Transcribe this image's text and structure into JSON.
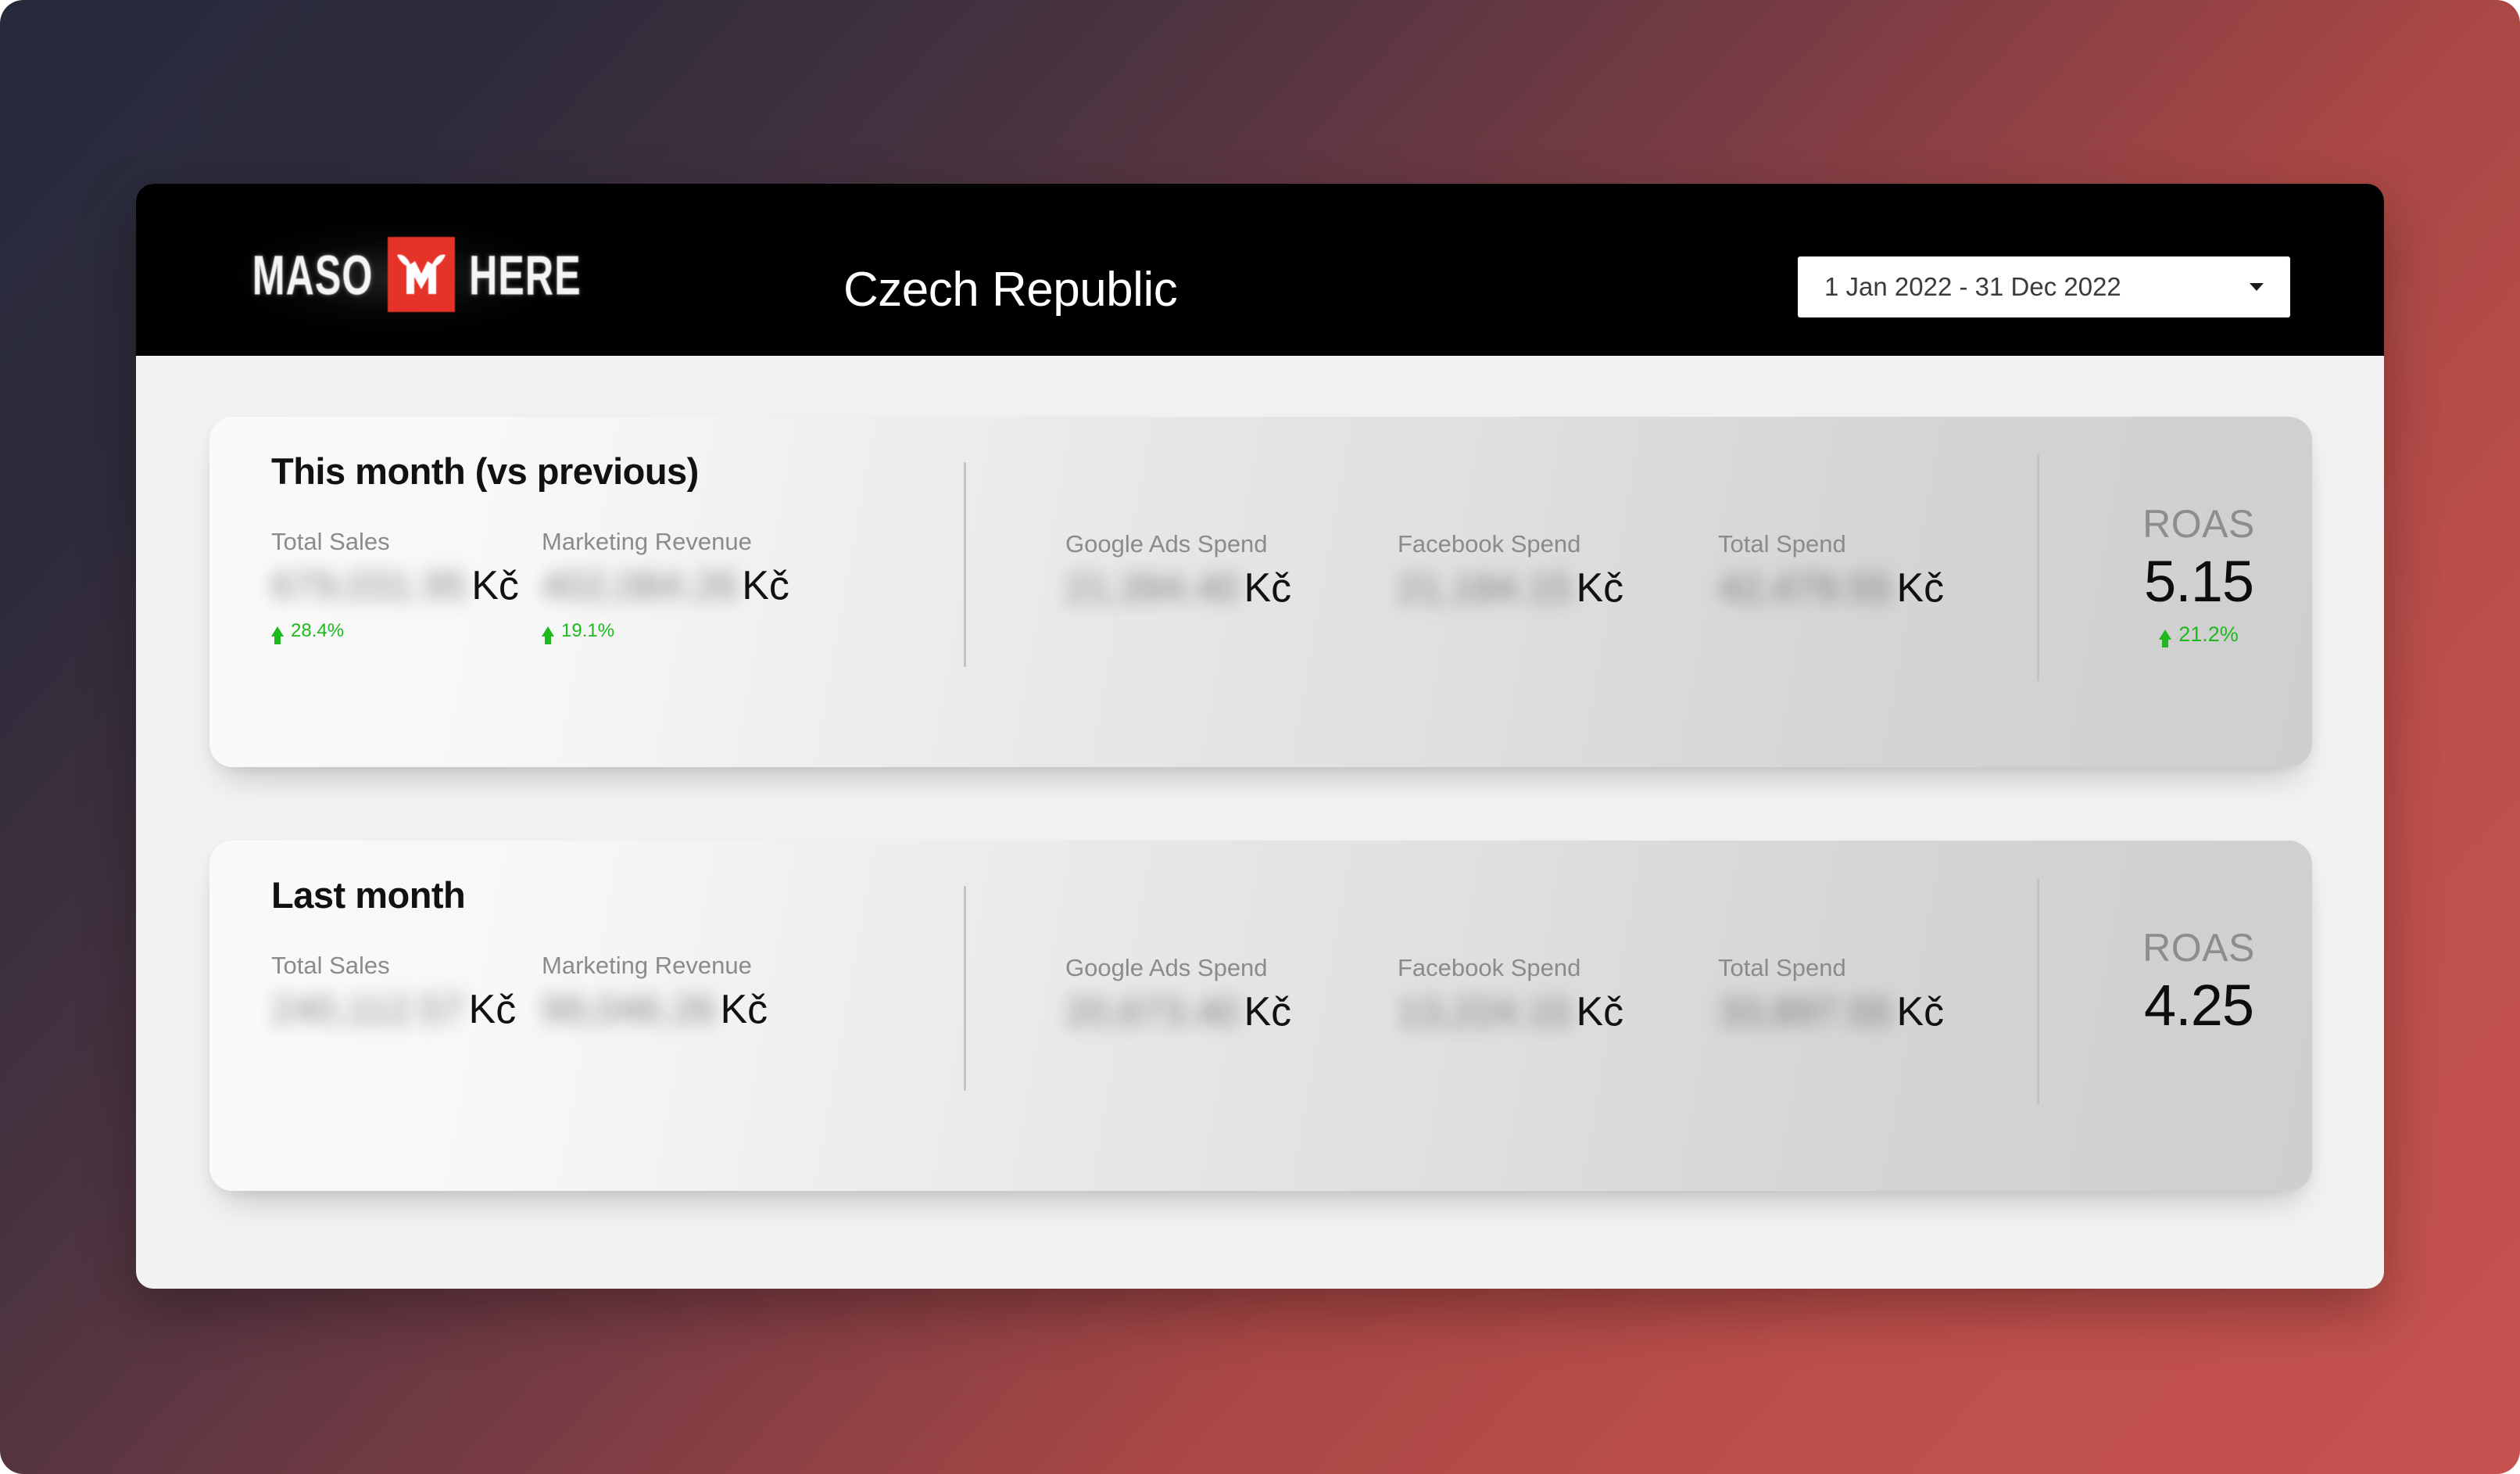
{
  "header": {
    "logo": {
      "word_left": "MASO",
      "word_right": "HERE",
      "mark_icon": "bull-head-m-icon"
    },
    "title": "Czech Republic",
    "date_range": {
      "value": "1 Jan 2022 - 31 Dec 2022",
      "caret_icon": "chevron-down-icon"
    }
  },
  "cards": [
    {
      "title": "This month (vs previous)",
      "metrics": [
        {
          "label": "Total Sales",
          "value": "679,031.95",
          "currency": "Kč",
          "delta": "28.4%",
          "delta_icon": "arrow-up-icon",
          "delta_direction": "up"
        },
        {
          "label": "Marketing Revenue",
          "value": "402,084.26",
          "currency": "Kč",
          "delta": "19.1%",
          "delta_icon": "arrow-up-icon",
          "delta_direction": "up"
        },
        {
          "label": "Google Ads Spend",
          "value": "21,394.40",
          "currency": "Kč"
        },
        {
          "label": "Facebook Spend",
          "value": "21,184.15",
          "currency": "Kč"
        },
        {
          "label": "Total Spend",
          "value": "42,479.55",
          "currency": "Kč"
        }
      ],
      "roas": {
        "label": "ROAS",
        "value": "5.15",
        "delta": "21.2%",
        "delta_icon": "arrow-up-icon",
        "delta_direction": "up"
      }
    },
    {
      "title": "Last month",
      "metrics": [
        {
          "label": "Total Sales",
          "value": "240,112.57",
          "currency": "Kč"
        },
        {
          "label": "Marketing Revenue",
          "value": "99,046.26",
          "currency": "Kč"
        },
        {
          "label": "Google Ads Spend",
          "value": "20,673.40",
          "currency": "Kč"
        },
        {
          "label": "Facebook Spend",
          "value": "13,224.15",
          "currency": "Kč"
        },
        {
          "label": "Total Spend",
          "value": "33,897.55",
          "currency": "Kč"
        }
      ],
      "roas": {
        "label": "ROAS",
        "value": "4.25"
      }
    }
  ],
  "colors": {
    "header_bg": "#000000",
    "accent_red": "#e63329",
    "positive_green": "#1db91d",
    "panel_bg": "#f2f2f2",
    "divider": "#bfc4cb"
  }
}
